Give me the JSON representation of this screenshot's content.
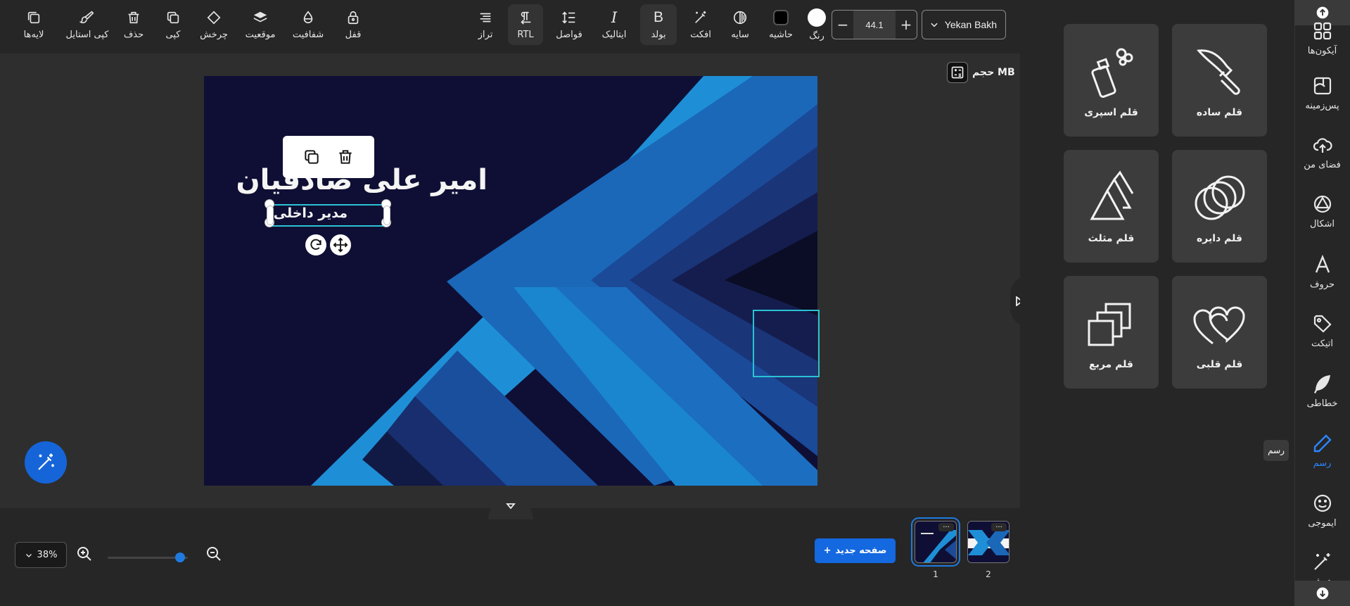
{
  "toolbar": {
    "layers": "لایه‌ها",
    "copy_style": "کپی استایل",
    "delete": "حذف",
    "copy": "کپی",
    "rotate": "چرخش",
    "position": "موقعیت",
    "opacity": "شفافیت",
    "lock": "قفل",
    "align": "تراز",
    "rtl": "RTL",
    "spacing": "فواصل",
    "italic": "ایتالیک",
    "bold": "بولد",
    "effect": "افکت",
    "shadow": "سایه",
    "border": "حاشیه",
    "color": "رنگ",
    "font_size": "44.1",
    "font_family": "Yekan Bakh",
    "border_color": "#000000",
    "text_color": "#ffffff"
  },
  "canvas": {
    "size_label": "حجم MB",
    "title_text": "امیر علی صادقیان",
    "selected_text": "مدیر داخلی",
    "background_color": "#0f0f35"
  },
  "bottom": {
    "zoom": "38%",
    "zoom_level": 0.9,
    "new_page": "صفحه جدید",
    "pages": [
      {
        "number": "1",
        "selected": true
      },
      {
        "number": "2",
        "selected": false
      }
    ],
    "thumb_dots": "..."
  },
  "panel": {
    "pens": [
      {
        "label": "قلم ساده",
        "icon": "brush-icon"
      },
      {
        "label": "قلم اسپری",
        "icon": "spray-can-icon"
      },
      {
        "label": "قلم دایره",
        "icon": "circles-icon"
      },
      {
        "label": "قلم مثلث",
        "icon": "triangles-icon"
      },
      {
        "label": "قلم قلبی",
        "icon": "hearts-icon"
      },
      {
        "label": "قلم مربع",
        "icon": "squares-icon"
      }
    ]
  },
  "sidebar": {
    "items": [
      {
        "label": "آیکون‌ها",
        "icon": "icons-grid-icon"
      },
      {
        "label": "پس‌زمینه",
        "icon": "background-icon"
      },
      {
        "label": "فضای من",
        "icon": "cloud-upload-icon"
      },
      {
        "label": "اشکال",
        "icon": "shapes-icon"
      },
      {
        "label": "حروف",
        "icon": "letter-a-icon"
      },
      {
        "label": "اتیکت",
        "icon": "tag-icon"
      },
      {
        "label": "خطاطی",
        "icon": "feather-icon"
      },
      {
        "label": "رسم",
        "icon": "pencil-icon",
        "active": true
      },
      {
        "label": "ایموجی",
        "icon": "smiley-icon"
      },
      {
        "label": "هوش",
        "icon": "magic-wand-icon"
      }
    ],
    "tooltip": "رسم",
    "accent": "#2a86ff"
  }
}
